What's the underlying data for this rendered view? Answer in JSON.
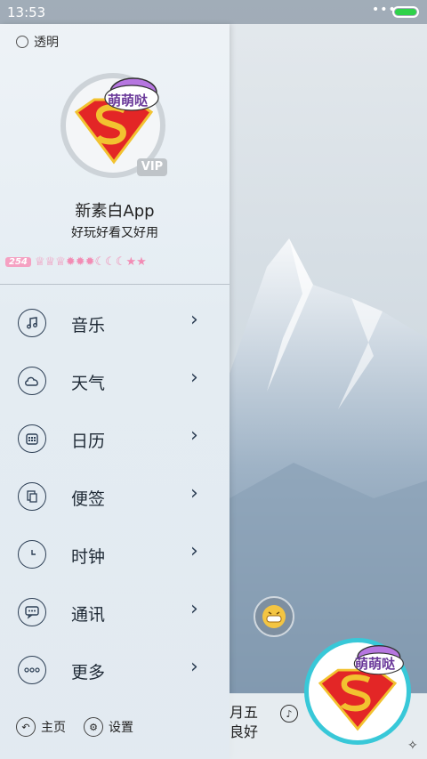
{
  "status_bar": {
    "time": "13:53",
    "dots": "•••"
  },
  "drawer": {
    "transparent_label": "透明",
    "vip_badge": "VIP",
    "sticker_text": "萌萌哒",
    "app_name": "新素白App",
    "tagline": "好玩好看又好用",
    "level": "254",
    "level_icons": "♕♕♕✹✹✹☾☾☾★★",
    "menu": [
      {
        "label": "音乐",
        "icon": "music-note-icon"
      },
      {
        "label": "天气",
        "icon": "cloud-icon"
      },
      {
        "label": "日历",
        "icon": "calendar-icon"
      },
      {
        "label": "便签",
        "icon": "notes-icon"
      },
      {
        "label": "时钟",
        "icon": "clock-icon"
      },
      {
        "label": "通讯",
        "icon": "chat-icon"
      },
      {
        "label": "更多",
        "icon": "more-icon"
      }
    ],
    "bottom": {
      "home": "主页",
      "settings": "设置"
    }
  },
  "right_panel": {
    "date_line1": "月五",
    "date_line2": "良好",
    "sticker_text": "萌萌哒"
  },
  "colors": {
    "accent_ring": "#38c8d8",
    "battery": "#2fd24a",
    "icon_stroke": "#2d3f55",
    "pink_level": "#f28cb4"
  }
}
